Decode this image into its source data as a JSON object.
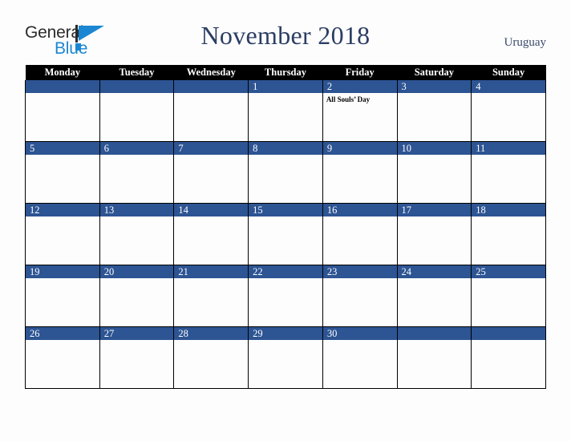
{
  "brand": {
    "name_top": "General",
    "name_bottom": "Blue",
    "accent_color": "#1b87d2",
    "text_color": "#2b2b2b",
    "triangle_icon": "triangle-icon"
  },
  "header": {
    "title": "November 2018",
    "locale": "Uruguay",
    "title_color": "#2c3e63",
    "locale_color": "#3a4a6b"
  },
  "calendar": {
    "header_bg": "#000000",
    "header_fg": "#ffffff",
    "daybar_bg": "#2d5493",
    "daybar_fg": "#ffffff",
    "cell_bg": "#fdfdfd",
    "grid_color": "#000000",
    "weekdays": [
      "Monday",
      "Tuesday",
      "Wednesday",
      "Thursday",
      "Friday",
      "Saturday",
      "Sunday"
    ],
    "weeks": [
      [
        {
          "day": "",
          "events": []
        },
        {
          "day": "",
          "events": []
        },
        {
          "day": "",
          "events": []
        },
        {
          "day": "1",
          "events": []
        },
        {
          "day": "2",
          "events": [
            "All Souls’ Day"
          ]
        },
        {
          "day": "3",
          "events": []
        },
        {
          "day": "4",
          "events": []
        }
      ],
      [
        {
          "day": "5",
          "events": []
        },
        {
          "day": "6",
          "events": []
        },
        {
          "day": "7",
          "events": []
        },
        {
          "day": "8",
          "events": []
        },
        {
          "day": "9",
          "events": []
        },
        {
          "day": "10",
          "events": []
        },
        {
          "day": "11",
          "events": []
        }
      ],
      [
        {
          "day": "12",
          "events": []
        },
        {
          "day": "13",
          "events": []
        },
        {
          "day": "14",
          "events": []
        },
        {
          "day": "15",
          "events": []
        },
        {
          "day": "16",
          "events": []
        },
        {
          "day": "17",
          "events": []
        },
        {
          "day": "18",
          "events": []
        }
      ],
      [
        {
          "day": "19",
          "events": []
        },
        {
          "day": "20",
          "events": []
        },
        {
          "day": "21",
          "events": []
        },
        {
          "day": "22",
          "events": []
        },
        {
          "day": "23",
          "events": []
        },
        {
          "day": "24",
          "events": []
        },
        {
          "day": "25",
          "events": []
        }
      ],
      [
        {
          "day": "26",
          "events": []
        },
        {
          "day": "27",
          "events": []
        },
        {
          "day": "28",
          "events": []
        },
        {
          "day": "29",
          "events": []
        },
        {
          "day": "30",
          "events": []
        },
        {
          "day": "",
          "events": []
        },
        {
          "day": "",
          "events": []
        }
      ]
    ]
  }
}
